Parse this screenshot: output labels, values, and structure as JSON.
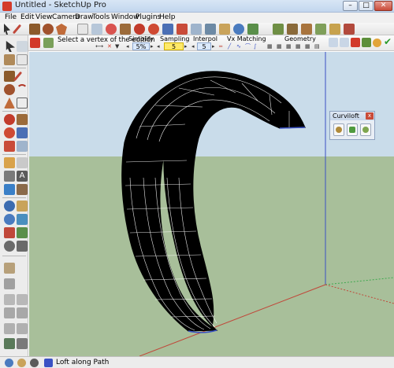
{
  "window": {
    "title": "Untitled - SketchUp Pro",
    "minimize": "–",
    "maximize": "□",
    "close": "✕"
  },
  "menu": [
    "File",
    "Edit",
    "View",
    "Camera",
    "Draw",
    "Tools",
    "Window",
    "Plugins",
    "Help"
  ],
  "curviloft_toolbar": {
    "hint": "Select a vertex of the edition",
    "simplify": {
      "label": "Simplify",
      "value": "5%"
    },
    "sampling": {
      "label": "Sampling",
      "value": "5"
    },
    "interpol": {
      "label": "Interpol",
      "value": "5"
    },
    "vx_matching": {
      "label": "Vx Matching"
    },
    "geometry": {
      "label": "Geometry"
    }
  },
  "panel": {
    "title": "Curviloft",
    "close": "x"
  },
  "status": {
    "text": "Loft along Path"
  },
  "colors": {
    "sky": "#c9dcea",
    "ground": "#a8bf9a",
    "surface": "#000000",
    "blue_axis": "#3a51c4",
    "red_axis": "#c0483a",
    "green_axis": "#3fa94f"
  }
}
